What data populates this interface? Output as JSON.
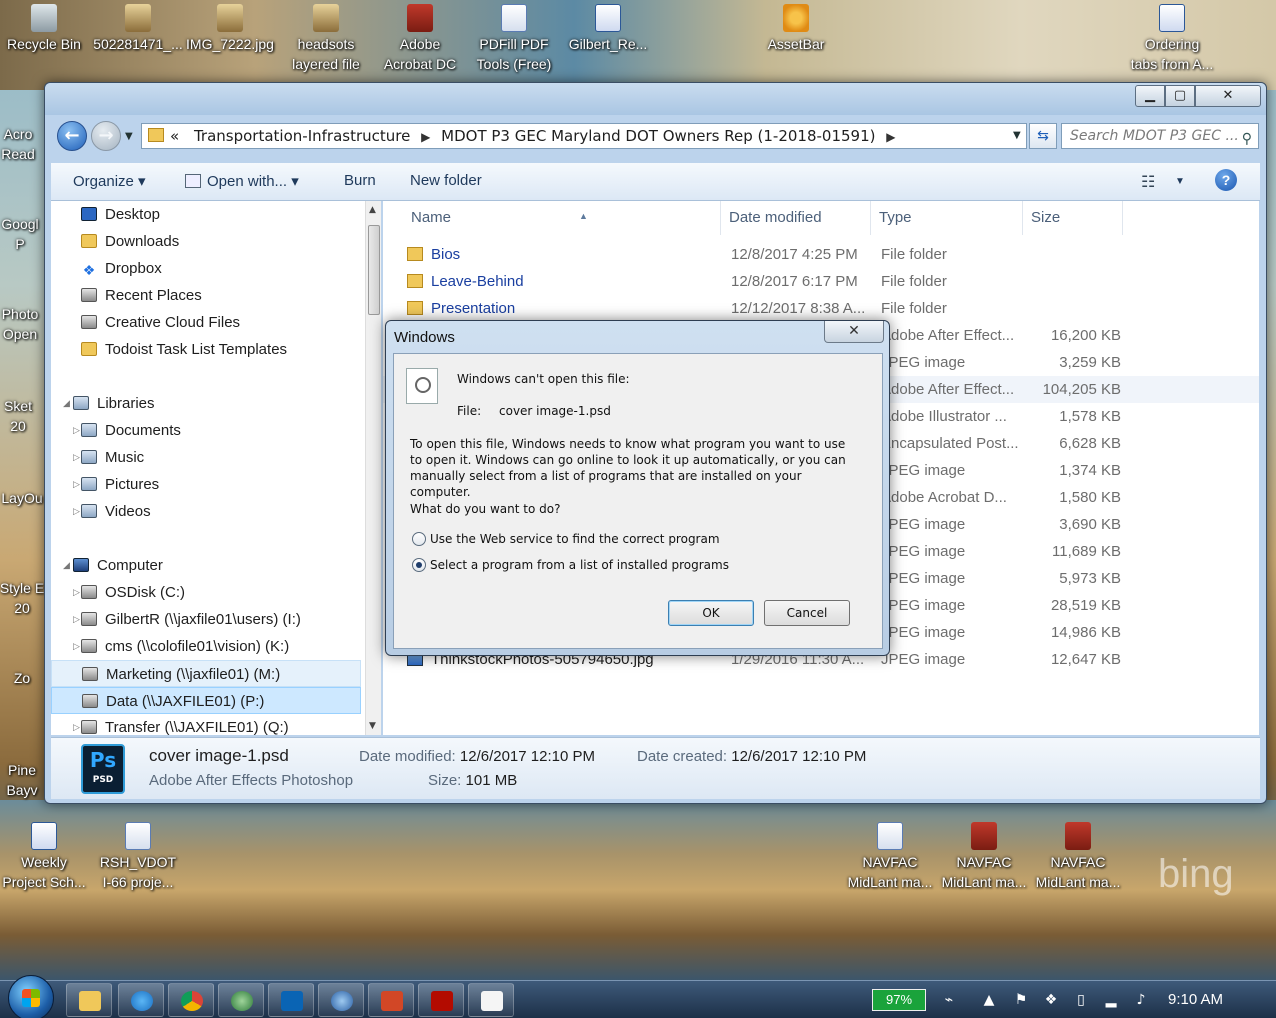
{
  "desktop": {
    "icons_top": [
      {
        "label": "Recycle Bin",
        "label2": ""
      },
      {
        "label": "502281471_...",
        "label2": ""
      },
      {
        "label": "IMG_7222.jpg",
        "label2": ""
      },
      {
        "label": "headsots",
        "label2": "layered file"
      },
      {
        "label": "Adobe",
        "label2": "Acrobat DC"
      },
      {
        "label": "PDFill PDF",
        "label2": "Tools (Free)"
      },
      {
        "label": "Gilbert_Re...",
        "label2": ""
      },
      {
        "label": "AssetBar",
        "label2": ""
      },
      {
        "label": "Ordering",
        "label2": "tabs from A..."
      }
    ],
    "icons_left": [
      {
        "label": "Acro",
        "label2": "Read"
      },
      {
        "label": "Googl",
        "label2": "P"
      },
      {
        "label": "Photo",
        "label2": "Open"
      },
      {
        "label": "Sket",
        "label2": "20"
      },
      {
        "label": "LayOu",
        "label2": ""
      },
      {
        "label": "Style E",
        "label2": "20"
      },
      {
        "label": "Zo",
        "label2": ""
      },
      {
        "label": "Pine",
        "label2": "Bayv"
      }
    ],
    "icons_bottom": [
      {
        "label": "Weekly",
        "label2": "Project Sch..."
      },
      {
        "label": "RSH_VDOT",
        "label2": "I-66 proje..."
      },
      {
        "label": "NAVFAC",
        "label2": "MidLant ma..."
      },
      {
        "label": "NAVFAC",
        "label2": "MidLant ma..."
      },
      {
        "label": "NAVFAC",
        "label2": "MidLant ma..."
      }
    ],
    "watermark": "bing"
  },
  "explorer": {
    "caption": {
      "min": "▁",
      "max": "▢",
      "close": "✕"
    },
    "address": {
      "prefix": "«",
      "crumbs": [
        "Transportation-Infrastructure",
        "MDOT P3 GEC Maryland DOT Owners Rep (1-2018-01591)"
      ],
      "search_placeholder": "Search MDOT P3 GEC ..."
    },
    "toolbar": {
      "organize": "Organize ▾",
      "open_with": "Open with... ▾",
      "burn": "Burn",
      "new_folder": "New folder",
      "view_icon": "view-options-icon",
      "help": "?"
    },
    "nav": {
      "favorites": [
        "Desktop",
        "Downloads",
        "Dropbox",
        "Recent Places",
        "Creative Cloud Files",
        "Todoist Task List Templates"
      ],
      "libraries_header": "Libraries",
      "libraries": [
        "Documents",
        "Music",
        "Pictures",
        "Videos"
      ],
      "computer_header": "Computer",
      "drives": [
        "OSDisk (C:)",
        "GilbertR (\\\\jaxfile01\\users) (I:)",
        "cms (\\\\colofile01\\vision) (K:)",
        "Marketing (\\\\jaxfile01) (M:)",
        "Data (\\\\JAXFILE01) (P:)",
        "Transfer (\\\\JAXFILE01) (Q:)"
      ]
    },
    "columns": {
      "name": "Name",
      "date": "Date modified",
      "type": "Type",
      "size": "Size"
    },
    "files": [
      {
        "name": "Bios",
        "date": "12/8/2017 4:25 PM",
        "type": "File folder",
        "size": "",
        "kind": "folder"
      },
      {
        "name": "Leave-Behind",
        "date": "12/8/2017 6:17 PM",
        "type": "File folder",
        "size": "",
        "kind": "folder"
      },
      {
        "name": "Presentation",
        "date": "12/12/2017 8:38 A...",
        "type": "File folder",
        "size": "",
        "kind": "folder"
      },
      {
        "name": "",
        "date": "",
        "type": "Adobe After Effect...",
        "size": "16,200 KB",
        "kind": "file"
      },
      {
        "name": "",
        "date": "",
        "type": "JPEG image",
        "size": "3,259 KB",
        "kind": "file"
      },
      {
        "name": "",
        "date": "",
        "type": "Adobe After Effect...",
        "size": "104,205 KB",
        "kind": "file"
      },
      {
        "name": "",
        "date": "",
        "type": "Adobe Illustrator ...",
        "size": "1,578 KB",
        "kind": "file"
      },
      {
        "name": "",
        "date": "",
        "type": "Encapsulated Post...",
        "size": "6,628 KB",
        "kind": "file"
      },
      {
        "name": "",
        "date": "",
        "type": "JPEG image",
        "size": "1,374 KB",
        "kind": "file"
      },
      {
        "name": "",
        "date": "",
        "type": "Adobe Acrobat D...",
        "size": "1,580 KB",
        "kind": "file"
      },
      {
        "name": "",
        "date": "",
        "type": "JPEG image",
        "size": "3,690 KB",
        "kind": "file"
      },
      {
        "name": "",
        "date": "",
        "type": "JPEG image",
        "size": "11,689 KB",
        "kind": "file"
      },
      {
        "name": "",
        "date": "",
        "type": "JPEG image",
        "size": "5,973 KB",
        "kind": "file"
      },
      {
        "name": "",
        "date": "",
        "type": "JPEG image",
        "size": "28,519 KB",
        "kind": "file"
      },
      {
        "name": "",
        "date": "",
        "type": "JPEG image",
        "size": "14,986 KB",
        "kind": "file"
      },
      {
        "name": "ThinkstockPhotos-505794650.jpg",
        "date": "1/29/2016 11:30 A...",
        "type": "JPEG image",
        "size": "12,647 KB",
        "kind": "jpg"
      }
    ],
    "details": {
      "icon_text": "Ps",
      "icon_sub": "PSD",
      "filename": "cover image-1.psd",
      "filetype": "Adobe After Effects Photoshop",
      "modified_label": "Date modified:",
      "modified_value": "12/6/2017 12:10 PM",
      "size_label": "Size:",
      "size_value": "101 MB",
      "created_label": "Date created:",
      "created_value": "12/6/2017 12:10 PM"
    }
  },
  "dialog": {
    "title": "Windows",
    "close": "✕",
    "heading": "Windows can't open this file:",
    "file_label": "File:",
    "file_value": "cover image-1.psd",
    "para": "To open this file, Windows needs to know what program you want to use to open it. Windows can go online to look it up automatically, or you can manually select from a list of programs that are installed on your computer.",
    "question": "What do you want to do?",
    "option1": "Use the Web service to find the correct program",
    "option2": "Select a program from a list of installed programs",
    "ok": "OK",
    "cancel": "Cancel"
  },
  "taskbar": {
    "battery": "97%",
    "time": "9:10 AM"
  }
}
